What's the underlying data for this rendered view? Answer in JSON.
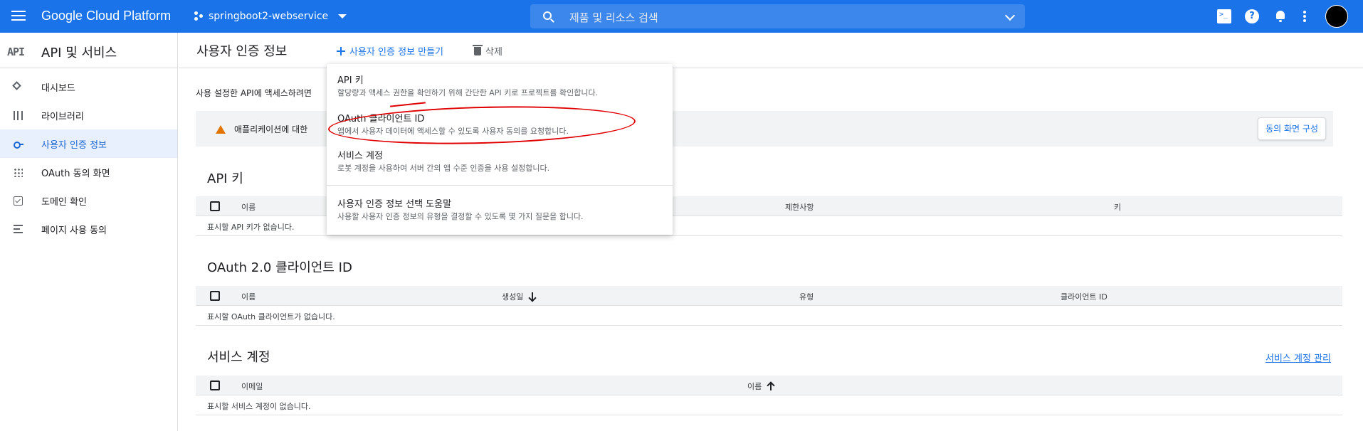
{
  "topbar": {
    "brand": "Google Cloud Platform",
    "project": "springboot2-webservice",
    "search_placeholder": "제품 및 리소스 검색"
  },
  "sidebar": {
    "logo": "API",
    "title": "API 및 서비스",
    "items": [
      {
        "label": "대시보드",
        "icon": "dashboard-icon"
      },
      {
        "label": "라이브러리",
        "icon": "library-icon"
      },
      {
        "label": "사용자 인증 정보",
        "icon": "key-icon",
        "active": true
      },
      {
        "label": "OAuth 동의 화면",
        "icon": "consent-icon"
      },
      {
        "label": "도메인 확인",
        "icon": "checkbox-icon"
      },
      {
        "label": "페이지 사용 동의",
        "icon": "settings-list-icon"
      }
    ]
  },
  "header": {
    "title": "사용자 인증 정보",
    "create_label": "사용자 인증 정보 만들기",
    "delete_label": "삭제"
  },
  "intro": "사용 설정한 API에 액세스하려면",
  "warning": {
    "text": "애플리케이션에 대한",
    "button": "동의 화면 구성"
  },
  "dropdown": [
    {
      "title": "API 키",
      "desc": "할당량과 액세스 권한을 확인하기 위해 간단한 API 키로 프로젝트를 확인합니다."
    },
    {
      "title": "OAuth 클라이언트 ID",
      "desc": "앱에서 사용자 데이터에 액세스할 수 있도록 사용자 동의를 요청합니다."
    },
    {
      "title": "서비스 계정",
      "desc": "로봇 계정을 사용하여 서버 간의 앱 수준 인증을 사용 설정합니다."
    },
    {
      "title": "사용자 인증 정보 선택 도움말",
      "desc": "사용할 사용자 인증 정보의 유형을 결정할 수 있도록 몇 가지 질문을 합니다."
    }
  ],
  "api_keys": {
    "title": "API 키",
    "columns": [
      "이름",
      "제한사항",
      "키"
    ],
    "empty": "표시할 API 키가 없습니다."
  },
  "oauth": {
    "title": "OAuth 2.0 클라이언트 ID",
    "columns": [
      "이름",
      "생성일",
      "유형",
      "클라이언트 ID"
    ],
    "empty": "표시할 OAuth 클라이언트가 없습니다."
  },
  "service_accounts": {
    "title": "서비스 계정",
    "manage_link": "서비스 계정 관리",
    "columns": [
      "이메일",
      "이름"
    ],
    "empty": "표시할 서비스 계정이 없습니다."
  },
  "colors": {
    "primary": "#1a73e8",
    "highlight": "#e00000",
    "warning": "#e37400"
  }
}
